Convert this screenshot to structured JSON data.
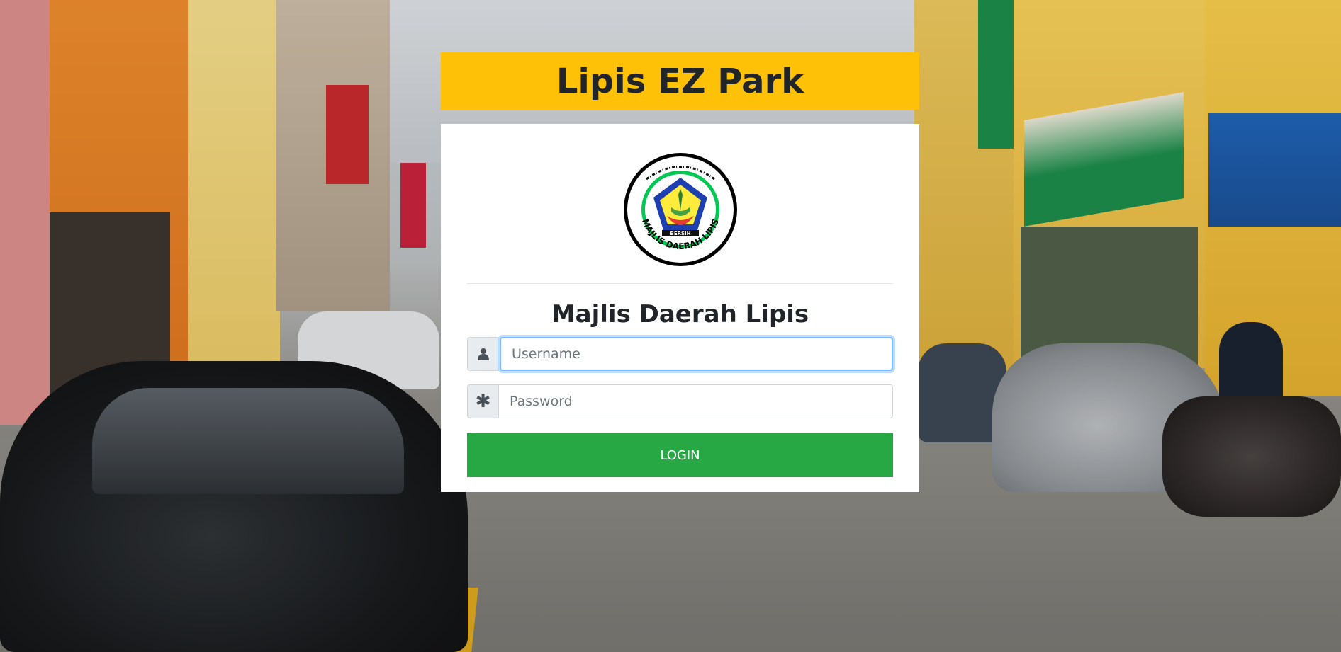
{
  "app": {
    "title": "Lipis EZ Park"
  },
  "logo": {
    "name": "majlis-daerah-lipis-seal",
    "text_bottom": "MAJLIS DAERAH LIPIS",
    "text_badge": "BERSIH"
  },
  "login": {
    "organization": "Majlis Daerah Lipis",
    "username_placeholder": "Username",
    "username_value": "",
    "username_icon": "user-icon",
    "password_placeholder": "Password",
    "password_value": "",
    "password_icon": "asterisk-icon",
    "button_label": "LOGIN"
  },
  "colors": {
    "title_bar": "#ffc107",
    "login_button": "#28a745",
    "card": "#ffffff",
    "text": "#212529"
  }
}
